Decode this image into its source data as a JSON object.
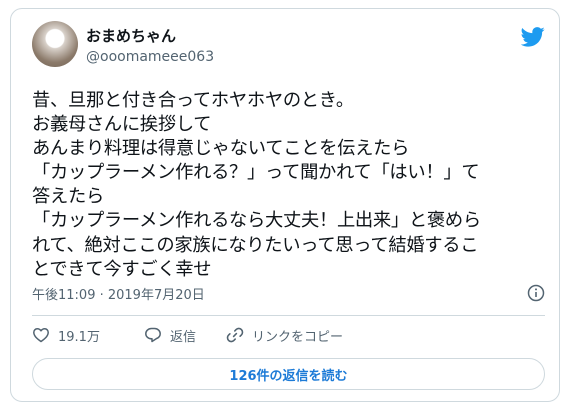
{
  "author": {
    "display_name": "おまめちゃん",
    "handle": "@ooomameee063"
  },
  "tweet": {
    "lines": [
      "昔、旦那と付き合ってホヤホヤのとき。",
      "お義母さんに挨拶して",
      "あんまり料理は得意じゃないてことを伝えたら",
      "「カップラーメン作れる？」って聞かれて「はい！」て",
      "答えたら",
      "「カップラーメン作れるなら大丈夫！上出来」と褒めら",
      "れて、絶対ここの家族になりたいって思って結婚するこ",
      "とできて今すごく幸せ"
    ],
    "timestamp": "午後11:09 · 2019年7月20日"
  },
  "actions": {
    "like_count": "19.1万",
    "reply_label": "返信",
    "copy_link_label": "リンクをコピー"
  },
  "replies_button": "126件の返信を読む",
  "colors": {
    "twitter_blue": "#1d9bf0",
    "reply_blue": "#1d7bd7",
    "muted": "#536471",
    "border": "#cfd9de"
  },
  "icons": {
    "brand": "twitter-bird-icon",
    "info": "info-icon",
    "like": "heart-icon",
    "reply": "comment-icon",
    "copy": "link-icon"
  }
}
